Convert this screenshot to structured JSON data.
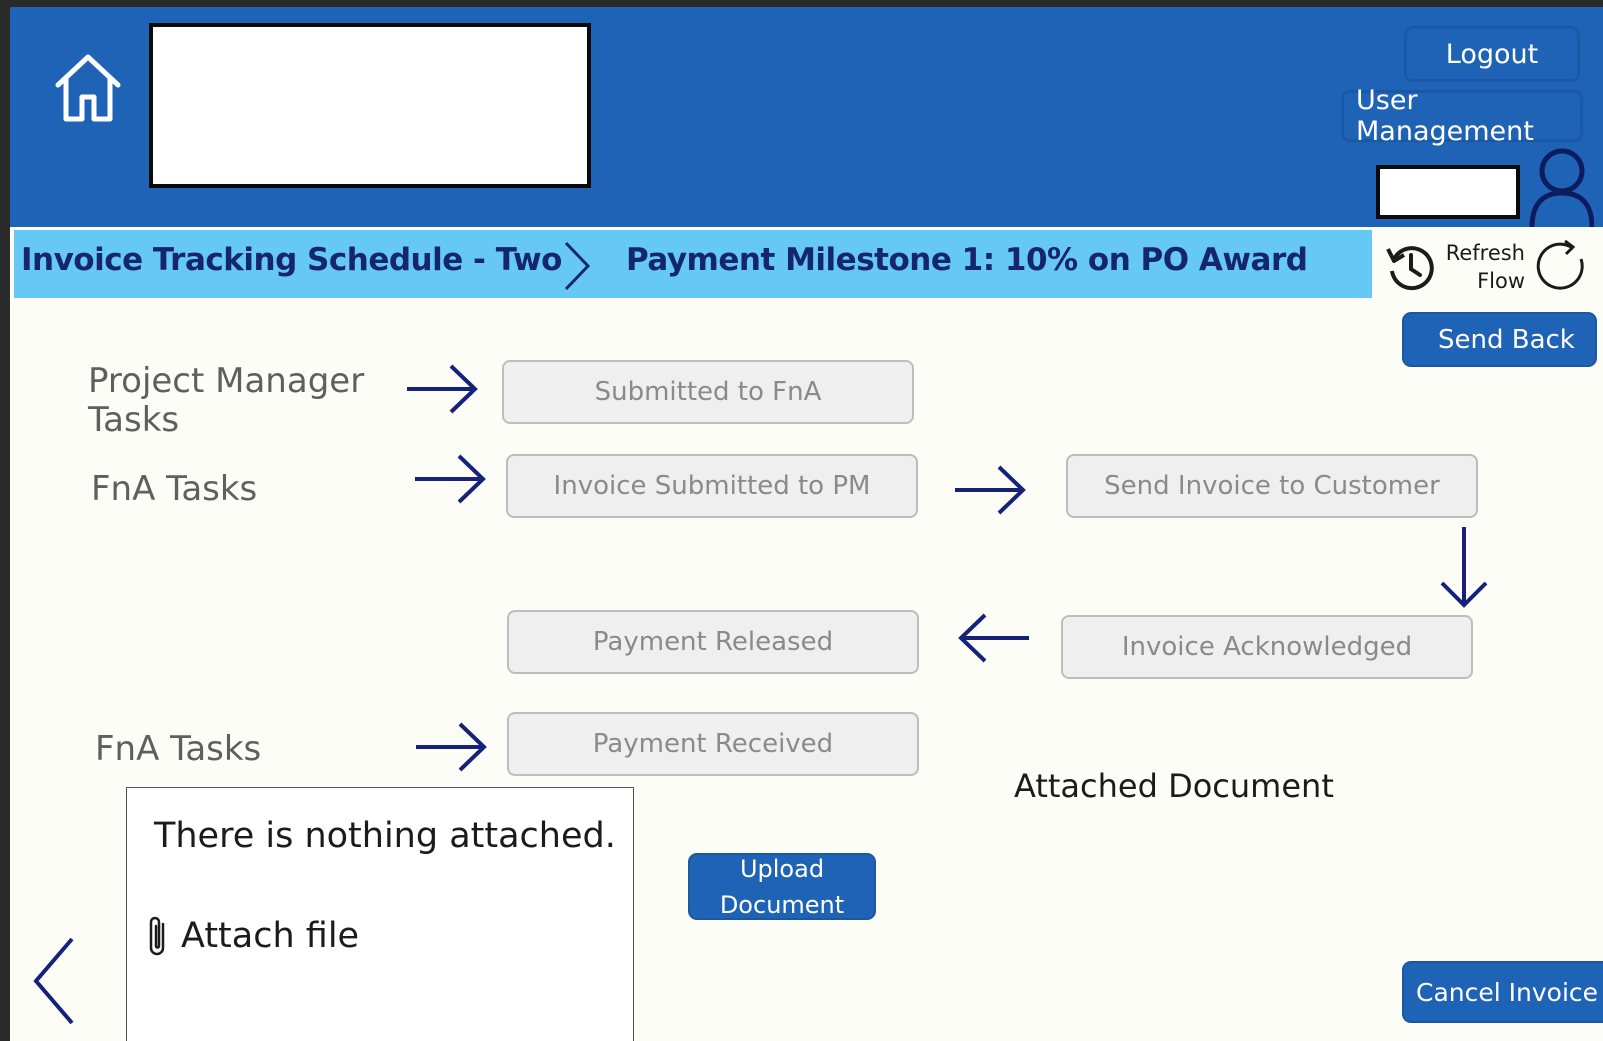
{
  "header": {
    "logout_label": "Logout",
    "user_management_label": "User Management"
  },
  "breadcrumb": {
    "schedule": "Invoice Tracking Schedule - Two",
    "milestone": "Payment Milestone 1: 10% on PO Award"
  },
  "refresh": {
    "label_line1": "Refresh",
    "label_line2": "Flow"
  },
  "actions": {
    "send_back": "Send Back",
    "upload_line1": "Upload",
    "upload_line2": "Document",
    "cancel_invoice": "Cancel Invoice"
  },
  "workflow": {
    "pm_label_line1": "Project Manager",
    "pm_label_line2": "Tasks",
    "fna_label_1": "FnA Tasks",
    "fna_label_2": "FnA Tasks",
    "submitted_to_fna": "Submitted to FnA",
    "invoice_submitted_to_pm": "Invoice Submitted to PM",
    "send_invoice_to_customer": "Send Invoice to Customer",
    "payment_released": "Payment Released",
    "invoice_acknowledged": "Invoice Acknowledged",
    "payment_received": "Payment Received"
  },
  "attachments": {
    "empty_message": "There is nothing attached.",
    "attach_file_label": "Attach file",
    "attached_title": "Attached Document"
  },
  "colors": {
    "header_blue": "#1f63b6",
    "breadcrumb_bg": "#66c9f5",
    "navy": "#15266e",
    "arrow": "#16217a"
  },
  "icons": {
    "home": "home-icon",
    "user": "user-icon",
    "history": "history-icon",
    "refresh": "refresh-icon",
    "paperclip": "paperclip-icon",
    "chevron_right": "chevron-right-icon",
    "chevron_left": "chevron-left-icon"
  }
}
